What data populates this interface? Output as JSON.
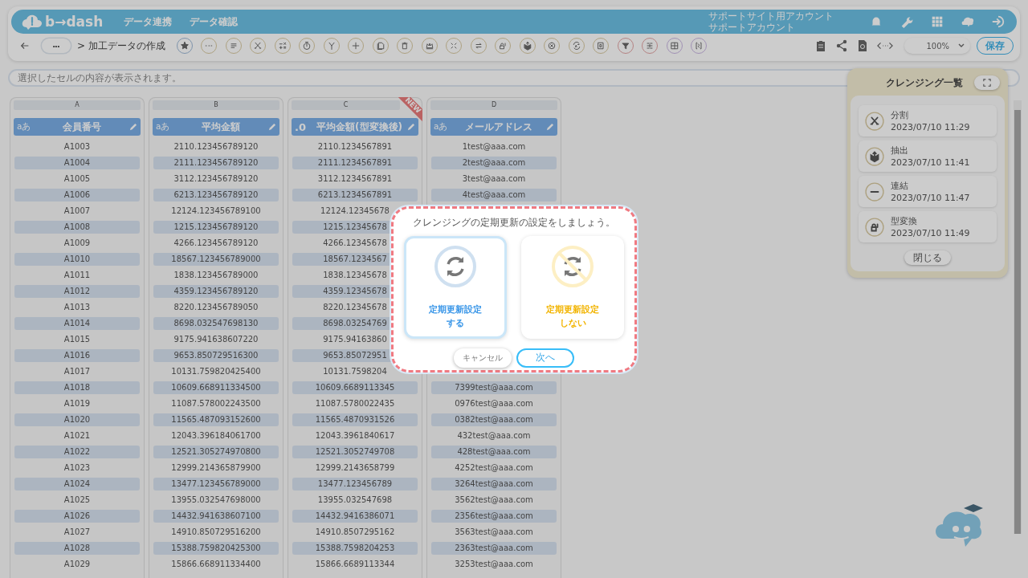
{
  "header": {
    "logo_text": "b→dash",
    "nav": [
      "データ連携",
      "データ確認"
    ],
    "account": [
      "サポートサイト用アカウント",
      "サポートアカウント"
    ]
  },
  "toolbar": {
    "more_label": "•••",
    "breadcrumb": "> 加工データの作成",
    "zoom": "100%",
    "save": "保存"
  },
  "formula_bar": {
    "placeholder": "選択したセルの内容が表示されます。"
  },
  "columns": [
    {
      "letter": "A",
      "type_badge": "aあ",
      "title": "会員番号"
    },
    {
      "letter": "B",
      "type_badge": "aあ",
      "title": "平均金額"
    },
    {
      "letter": "C",
      "type_badge": ".0",
      "title": "平均金額(型変換後)",
      "new_label": "NEW"
    },
    {
      "letter": "D",
      "type_badge": "aあ",
      "title": "メールアドレス"
    }
  ],
  "rows": [
    [
      "A1003",
      "2110.123456789120",
      "2110.1234567891",
      "1test@aaa.com"
    ],
    [
      "A1004",
      "2111.123456789120",
      "2111.1234567891",
      "2test@aaa.com"
    ],
    [
      "A1005",
      "3112.123456789120",
      "3112.1234567891",
      "3test@aaa.com"
    ],
    [
      "A1006",
      "6213.123456789120",
      "6213.1234567891",
      "4test@aaa.com"
    ],
    [
      "A1007",
      "12124.123456789100",
      "12124.12345678",
      null
    ],
    [
      "A1008",
      "1215.123456789120",
      "1215.12345678",
      null
    ],
    [
      "A1009",
      "4266.123456789120",
      "4266.12345678",
      null
    ],
    [
      "A1010",
      "18567.123456789000",
      "18567.1234567",
      null
    ],
    [
      "A1011",
      "1838.123456789000",
      "1838.12345678",
      null
    ],
    [
      "A1012",
      "4359.123456789120",
      "4359.12345678",
      null
    ],
    [
      "A1013",
      "8220.123456789050",
      "8220.12345678",
      null
    ],
    [
      "A1014",
      "8698.032547698130",
      "8698.03254769",
      null
    ],
    [
      "A1015",
      "9175.941638607220",
      "9175.94163860",
      null
    ],
    [
      "A1016",
      "9653.850729516300",
      "9653.85072951",
      null
    ],
    [
      "A1017",
      "10131.759820425400",
      "10131.7598204",
      null
    ],
    [
      "A1018",
      "10609.668911334500",
      "10609.6689113345",
      "7399test@aaa.com"
    ],
    [
      "A1019",
      "11087.578002243500",
      "11087.5780022435",
      "0976test@aaa.com"
    ],
    [
      "A1020",
      "11565.487093152600",
      "11565.4870931526",
      "0382test@aaa.com"
    ],
    [
      "A1021",
      "12043.396184061700",
      "12043.3961840617",
      "432test@aaa.com"
    ],
    [
      "A1022",
      "12521.305274970800",
      "12521.3052749708",
      "428test@aaa.com"
    ],
    [
      "A1023",
      "12999.214365879900",
      "12999.2143658799",
      "4252test@aaa.com"
    ],
    [
      "A1024",
      "13477.123456789000",
      "13477.123456789",
      "3264test@aaa.com"
    ],
    [
      "A1025",
      "13955.032547698000",
      "13955.032547698",
      "3562test@aaa.com"
    ],
    [
      "A1026",
      "14432.941638607100",
      "14432.9416386071",
      "2356test@aaa.com"
    ],
    [
      "A1027",
      "14910.850729516200",
      "14910.8507295162",
      "3563test@aaa.com"
    ],
    [
      "A1028",
      "15388.759820425300",
      "15388.7598204253",
      "2363test@aaa.com"
    ],
    [
      "A1029",
      "15866.668911334400",
      "15866.6689113344",
      "3253test@aaa.com"
    ]
  ],
  "cleansing_panel": {
    "title": "クレンジング一覧",
    "items": [
      {
        "kind": "split",
        "label": "分割",
        "time": "2023/07/10 11:29"
      },
      {
        "kind": "extract",
        "label": "抽出",
        "time": "2023/07/10 11:41"
      },
      {
        "kind": "concat",
        "label": "連結",
        "time": "2023/07/10 11:47"
      },
      {
        "kind": "convert",
        "label": "型変換",
        "time": "2023/07/10 11:49"
      }
    ],
    "close": "閉じる"
  },
  "dialog": {
    "message": "クレンジングの定期更新の設定をしましょう。",
    "options": [
      {
        "kind": "on",
        "lines": [
          "定期更新設定",
          "する"
        ],
        "selected": true
      },
      {
        "kind": "off",
        "lines": [
          "定期更新設定",
          "しない"
        ],
        "selected": false
      }
    ],
    "cancel": "キャンセル",
    "next": "次へ"
  }
}
